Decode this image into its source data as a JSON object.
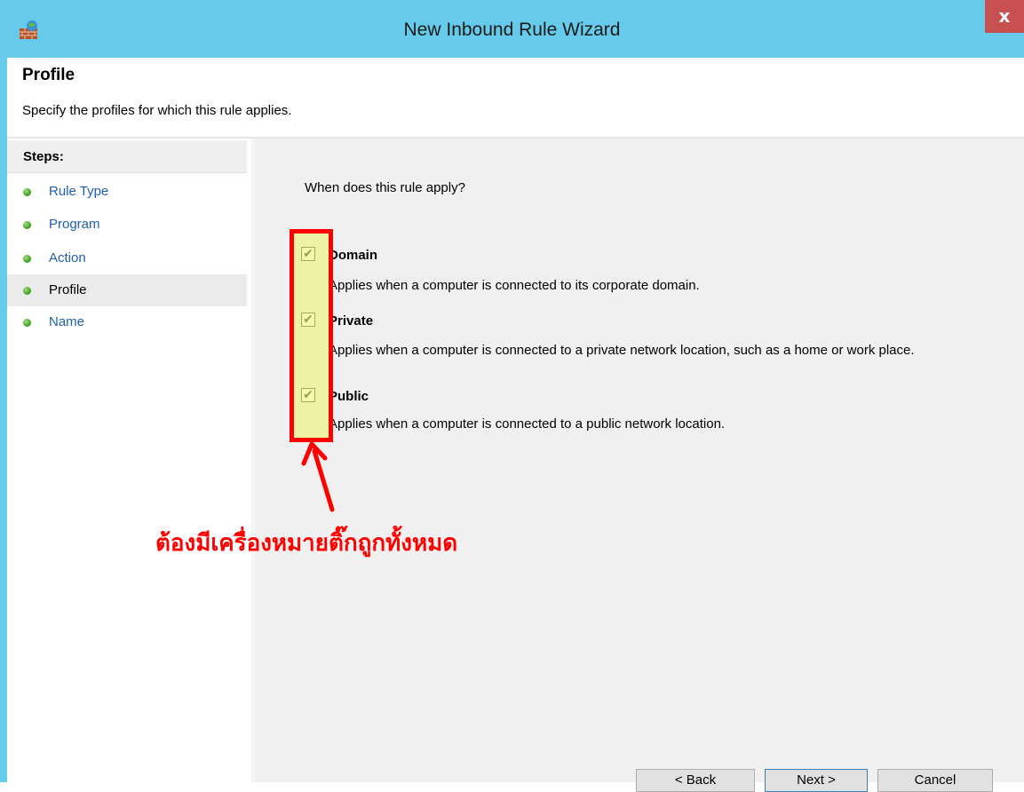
{
  "window": {
    "title": "New Inbound Rule Wizard",
    "close_label": "x",
    "app_icon": "firewall-icon"
  },
  "header": {
    "title": "Profile",
    "subtitle": "Specify the profiles for which this rule applies."
  },
  "sidebar": {
    "steps_title": "Steps:",
    "items": [
      {
        "label": "Rule Type",
        "current": false
      },
      {
        "label": "Program",
        "current": false
      },
      {
        "label": "Action",
        "current": false
      },
      {
        "label": "Profile",
        "current": true
      },
      {
        "label": "Name",
        "current": false
      }
    ]
  },
  "main": {
    "question": "When does this rule apply?",
    "options": [
      {
        "label": "Domain",
        "checked": true,
        "description": "Applies when a computer is connected to its corporate domain."
      },
      {
        "label": "Private",
        "checked": true,
        "description": "Applies when a computer is connected to a private network location, such as a home or work place."
      },
      {
        "label": "Public",
        "checked": true,
        "description": "Applies when a computer is connected to a public network location."
      }
    ]
  },
  "annotation": {
    "text": "ต้องมีเครื่องหมายติ๊กถูกทั้งหมด",
    "color": "#ff0000"
  },
  "buttons": {
    "back": "< Back",
    "next": "Next >",
    "cancel": "Cancel"
  },
  "colors": {
    "titlebar": "#66cbea",
    "close": "#c75050",
    "link": "#1e5fb0",
    "highlight_border": "#ff0000"
  }
}
